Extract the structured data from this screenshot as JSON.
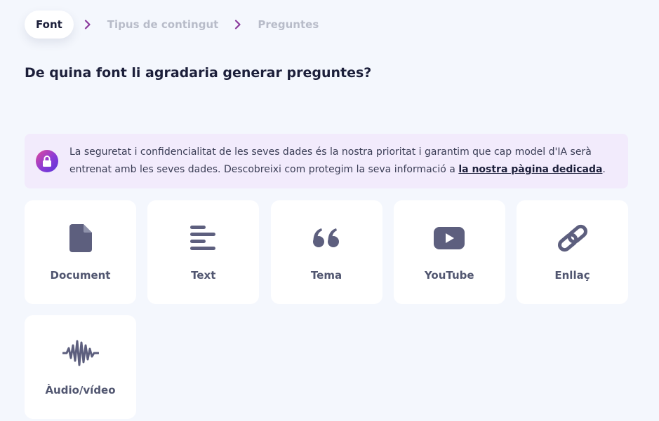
{
  "stepper": {
    "steps": [
      {
        "label": "Font",
        "active": true
      },
      {
        "label": "Tipus de contingut",
        "active": false
      },
      {
        "label": "Preguntes",
        "active": false
      }
    ],
    "chevron_color": "#8b3a9c"
  },
  "heading": "De quina font li agradaria generar preguntes?",
  "notice": {
    "icon": "lock-icon",
    "text": "La seguretat i confidencialitat de les seves dades és la nostra prioritat i garantim que cap model d'IA serà entrenat amb les seves dades. Descobreixi com protegim la seva informació a ",
    "link": "la nostra pàgina dedicada",
    "suffix": "."
  },
  "sources": [
    {
      "label": "Document",
      "icon": "document-icon"
    },
    {
      "label": "Text",
      "icon": "text-lines-icon"
    },
    {
      "label": "Tema",
      "icon": "quote-icon"
    },
    {
      "label": "YouTube",
      "icon": "youtube-icon"
    },
    {
      "label": "Enllaç",
      "icon": "link-icon"
    },
    {
      "label": "Àudio/vídeo",
      "icon": "audio-wave-icon"
    }
  ],
  "colors": {
    "background": "#f4f7fd",
    "notice_bg": "#f2ebfc",
    "icon": "#5d5f7e",
    "label": "#515670"
  }
}
